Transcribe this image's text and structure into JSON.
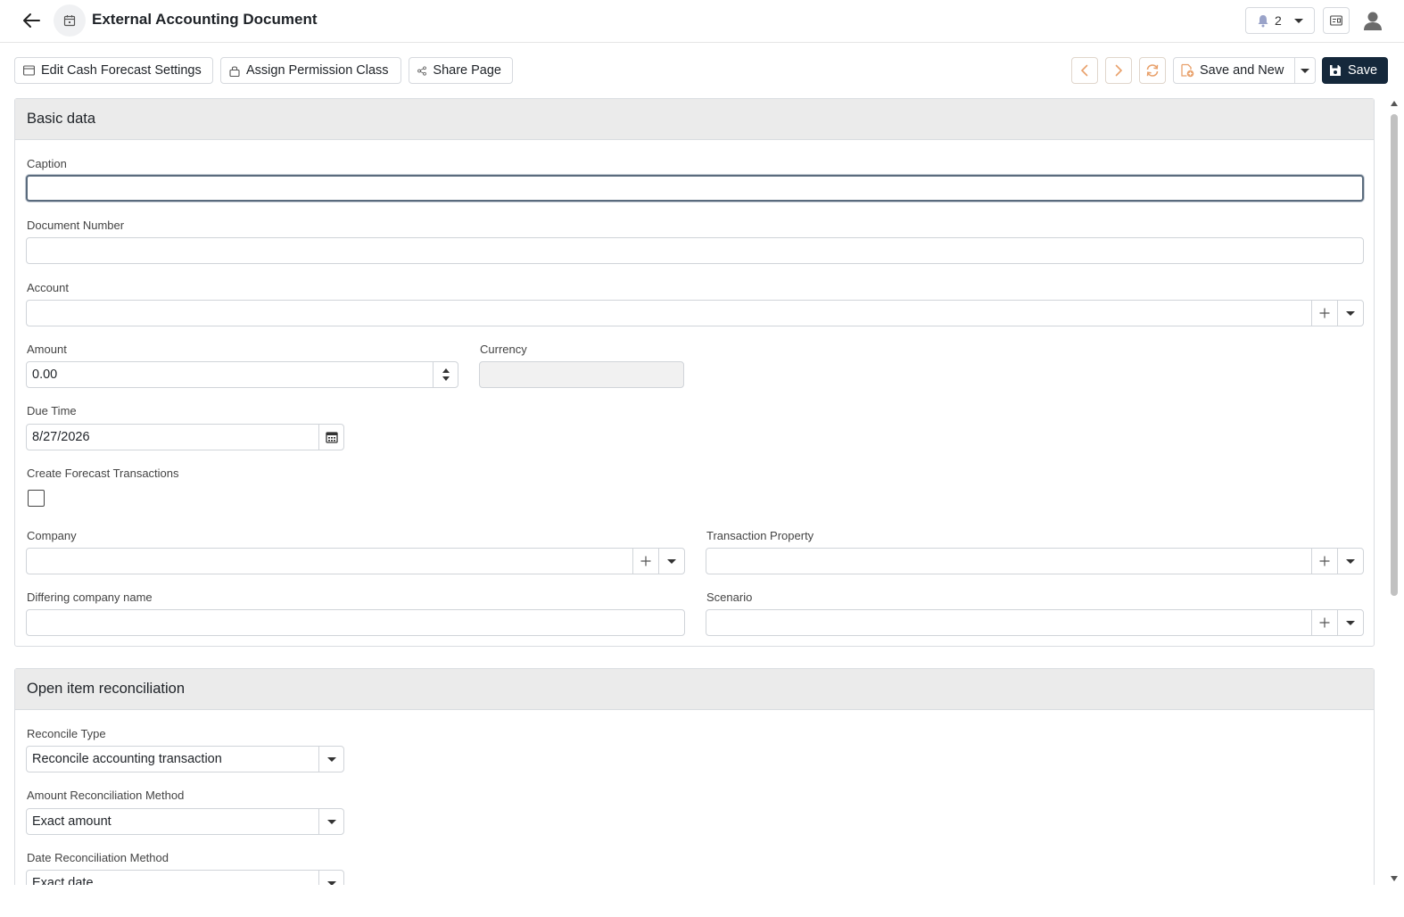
{
  "header": {
    "title": "External Accounting Document",
    "notification_count": "2"
  },
  "toolbar": {
    "edit_cash_forecast": "Edit Cash Forecast Settings",
    "assign_permission": "Assign Permission Class",
    "share_page": "Share Page",
    "save_and_new": "Save and New",
    "save": "Save"
  },
  "colors": {
    "primary": "#15283b",
    "nav_accent": "#e8a06a",
    "section_header_bg": "#ebebeb"
  },
  "basic_data": {
    "title": "Basic data",
    "caption": {
      "label": "Caption",
      "value": ""
    },
    "document_number": {
      "label": "Document Number",
      "value": ""
    },
    "account": {
      "label": "Account",
      "value": ""
    },
    "amount": {
      "label": "Amount",
      "value": "0.00"
    },
    "currency": {
      "label": "Currency",
      "value": ""
    },
    "due_time": {
      "label": "Due Time",
      "value": "8/27/2026"
    },
    "create_forecast": {
      "label": "Create Forecast Transactions",
      "checked": false
    },
    "company": {
      "label": "Company",
      "value": ""
    },
    "transaction_property": {
      "label": "Transaction Property",
      "value": ""
    },
    "differing_company_name": {
      "label": "Differing company name",
      "value": ""
    },
    "scenario": {
      "label": "Scenario",
      "value": ""
    }
  },
  "open_item": {
    "title": "Open item reconciliation",
    "reconcile_type": {
      "label": "Reconcile Type",
      "value": "Reconcile accounting transaction"
    },
    "amount_method": {
      "label": "Amount Reconciliation Method",
      "value": "Exact amount"
    },
    "date_method": {
      "label": "Date Reconciliation Method",
      "value": "Exact date"
    }
  },
  "icons": [
    "back-arrow-icon",
    "calendar-icon",
    "bell-icon",
    "chevron-down-icon",
    "id-card-icon",
    "user-icon",
    "window-icon",
    "lock-icon",
    "share-icon",
    "chevron-left-icon",
    "chevron-right-icon",
    "refresh-icon",
    "save-new-icon",
    "save-icon",
    "plus-icon"
  ]
}
